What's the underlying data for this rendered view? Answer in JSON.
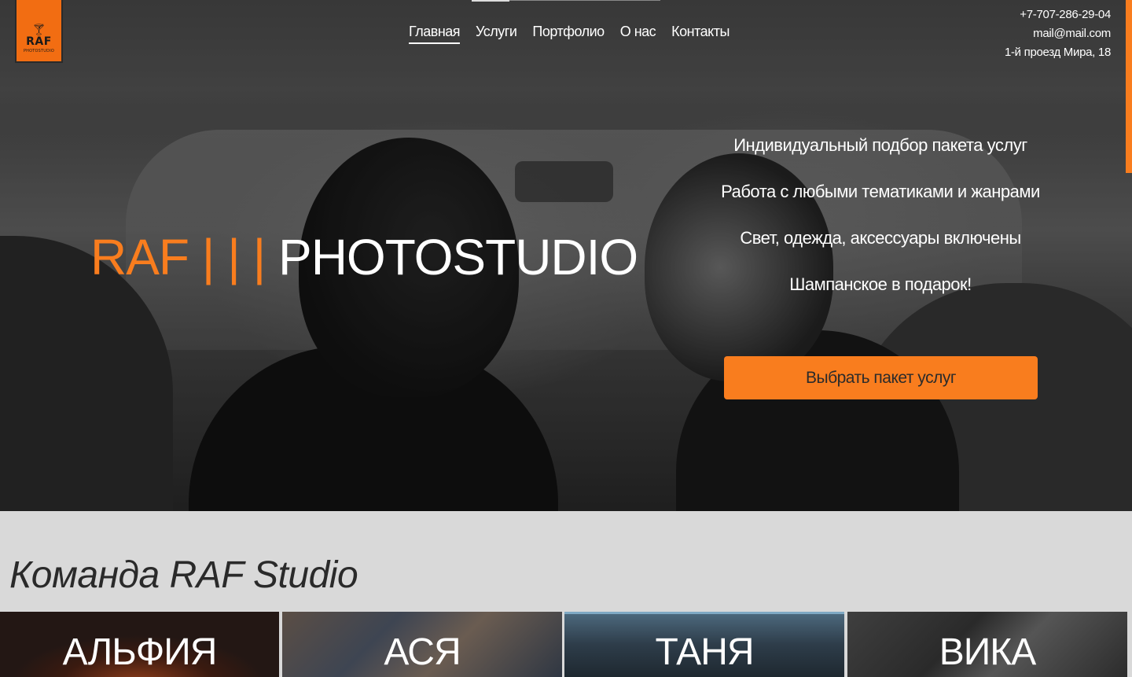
{
  "logo": {
    "main": "RAF",
    "sub": "PHOTOSTUDIO",
    "icon": "champagne-glass-icon"
  },
  "nav": {
    "items": [
      {
        "label": "Главная",
        "active": true
      },
      {
        "label": "Услуги"
      },
      {
        "label": "Портфолио"
      },
      {
        "label": "О нас"
      },
      {
        "label": "Контакты"
      }
    ]
  },
  "contacts": {
    "phone": "+7-707-286-29-04",
    "email": "mail@mail.com",
    "address": "1-й проезд Мира, 18"
  },
  "hero": {
    "brand": "RAF",
    "separator": "| | |",
    "title": "PHOTOSTUDIO",
    "features": [
      "Индивидуальный подбор пакета услуг",
      "Работа с любыми тематиками и жанрами",
      "Свет, одежда, аксессуары включены",
      "Шампанское в подарок!"
    ],
    "cta_label": "Выбрать пакет услуг"
  },
  "team": {
    "title": "Команда RAF Studio",
    "members": [
      "АЛЬФИЯ",
      "АСЯ",
      "ТАНЯ",
      "ВИКА"
    ]
  },
  "colors": {
    "accent": "#f97d1e",
    "light_bg": "#d9d9d9",
    "text_dark": "#2a2a2a"
  }
}
